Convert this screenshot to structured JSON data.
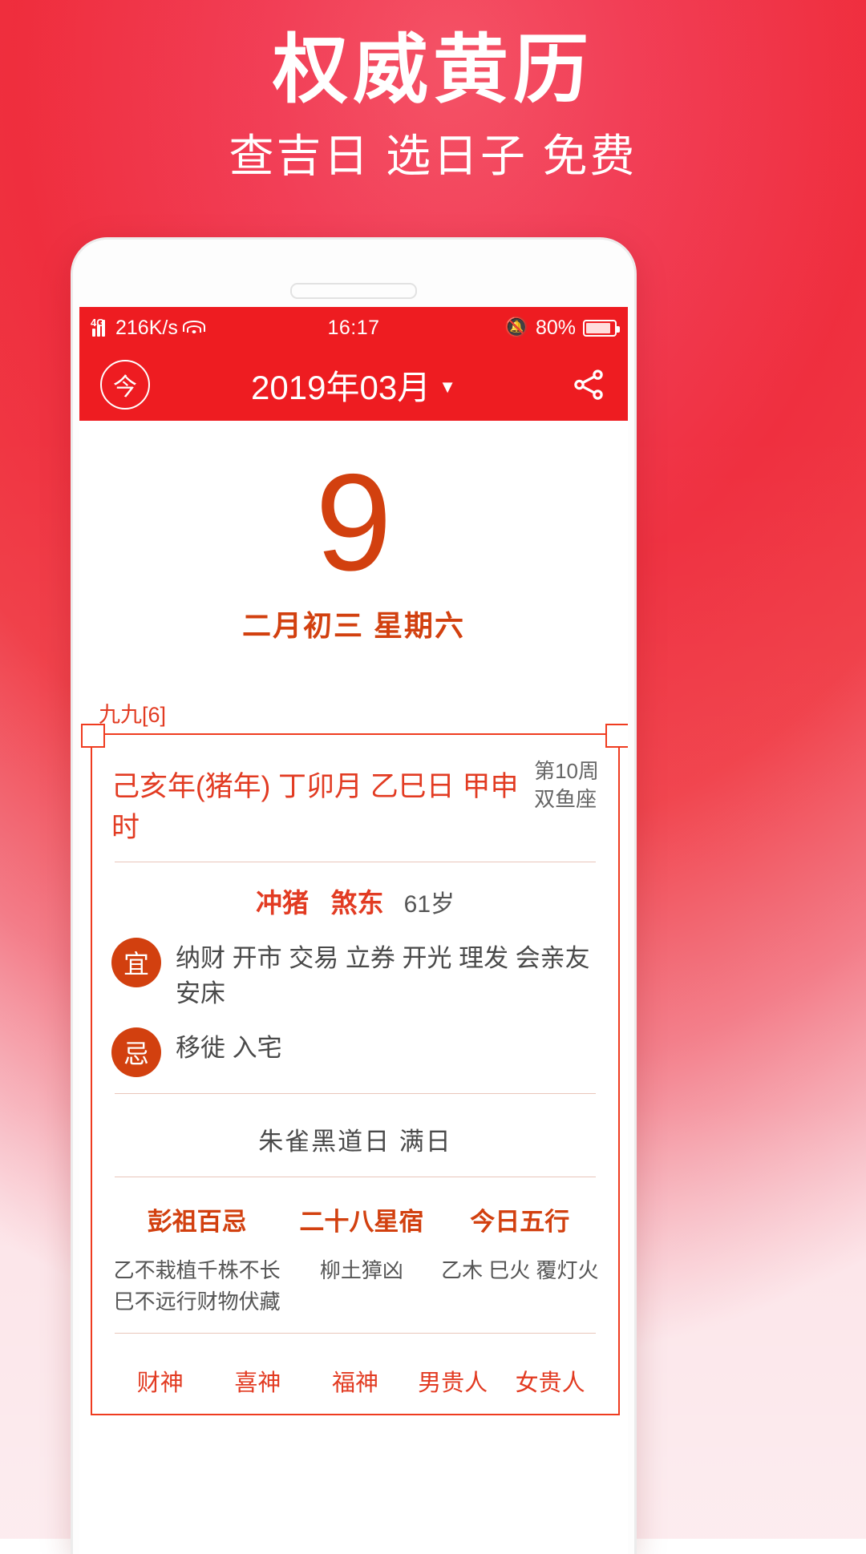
{
  "promo": {
    "title": "权威黄历",
    "subtitle": "查吉日 选日子 免费"
  },
  "colors": {
    "brand_red": "#ee1c21",
    "accent_orange": "#d2400f",
    "card_border": "#ef3c20",
    "text_grey": "#4a4a4a"
  },
  "statusbar": {
    "network_type": "4G",
    "speed": "216K/s",
    "wifi_icon": "wifi-icon",
    "time": "16:17",
    "mute_icon": "bell-mute-icon",
    "battery_percent": "80%"
  },
  "appbar": {
    "today_label": "今",
    "title": "2019年03月",
    "caret": "▼",
    "share_icon": "share-icon"
  },
  "date": {
    "day": "9",
    "lunar_weekday": "二月初三  星期六"
  },
  "almanac": {
    "jiujiu_label": "九九[6]",
    "ganzhi": "己亥年(猪年) 丁卯月 乙巳日 甲申时",
    "week_of_year": "第10周",
    "zodiac_sign": "双鱼座",
    "chong": "冲猪",
    "sha": "煞东",
    "age": "61岁",
    "yi_badge": "宜",
    "yi_text": "纳财 开市 交易 立券 开光 理发 会亲友 安床",
    "ji_badge": "忌",
    "ji_text": "移徙 入宅",
    "day_officer": "朱雀黑道日   满日",
    "columns": [
      {
        "head": "彭祖百忌",
        "body": "乙不栽植千株不长\n巳不远行财物伏藏"
      },
      {
        "head": "二十八星宿",
        "body": "柳土獐凶"
      },
      {
        "head": "今日五行",
        "body": "乙木 巳火 覆灯火"
      }
    ],
    "deities": [
      "财神",
      "喜神",
      "福神",
      "男贵人",
      "女贵人"
    ]
  }
}
